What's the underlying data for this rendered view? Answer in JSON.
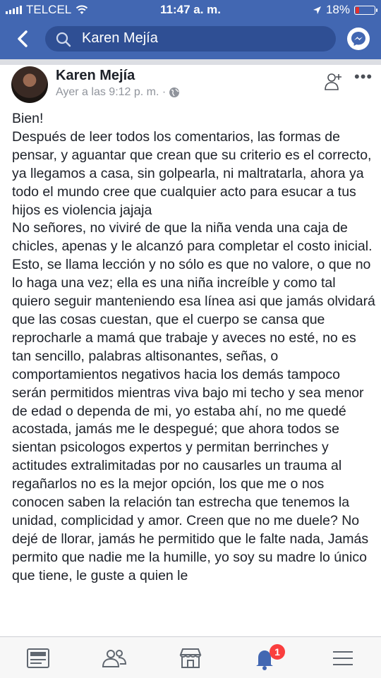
{
  "status_bar": {
    "carrier": "TELCEL",
    "time": "11:47 a. m.",
    "battery": "18%",
    "battery_level": 0.18
  },
  "top_bar": {
    "search_query": "Karen Mejía"
  },
  "post": {
    "author": "Karen Mejía",
    "timestamp": "Ayer a las 9:12 p. m. ·",
    "paragraphs": [
      "Bien!",
      "Después de leer todos los comentarios, las formas de pensar, y aguantar que crean que su criterio es el correcto, ya llegamos a casa, sin golpearla, ni maltratarla, ahora ya todo el mundo cree que cualquier acto para esucar a tus hijos es violencia jajaja",
      "No señores, no viviré de que la niña venda una caja de chicles, apenas y le alcanzó para completar el costo inicial.",
      "Esto, se llama lección y no sólo es que no valore, o que no lo haga una vez; ella es una niña increíble y como tal quiero seguir manteniendo esa línea asi que jamás olvidará que las cosas cuestan, que el cuerpo se cansa que reprocharle a mamá que trabaje y aveces no esté, no es tan sencillo, palabras altisonantes, señas, o comportamientos negativos hacia los demás tampoco serán permitidos mientras viva bajo mi techo y sea menor de edad o dependa de mi, yo estaba ahí, no me quedé acostada, jamás me le despegué; que ahora todos se sientan psicologos expertos y permitan berrinches y actitudes extralimitadas por no causarles un trauma al regañarlos no es la mejor opción, los que me o nos conocen saben la relación tan estrecha que tenemos la unidad, complicidad y amor. Creen que no me duele? No dejé de llorar, jamás he permitido que le falte nada, Jamás permito que nadie me la humille, yo soy su madre lo único que tiene, le guste a quien le"
    ]
  },
  "tab_bar": {
    "notifications_badge": "1",
    "tabs": [
      "news-feed",
      "friends",
      "marketplace",
      "notifications",
      "menu"
    ]
  }
}
